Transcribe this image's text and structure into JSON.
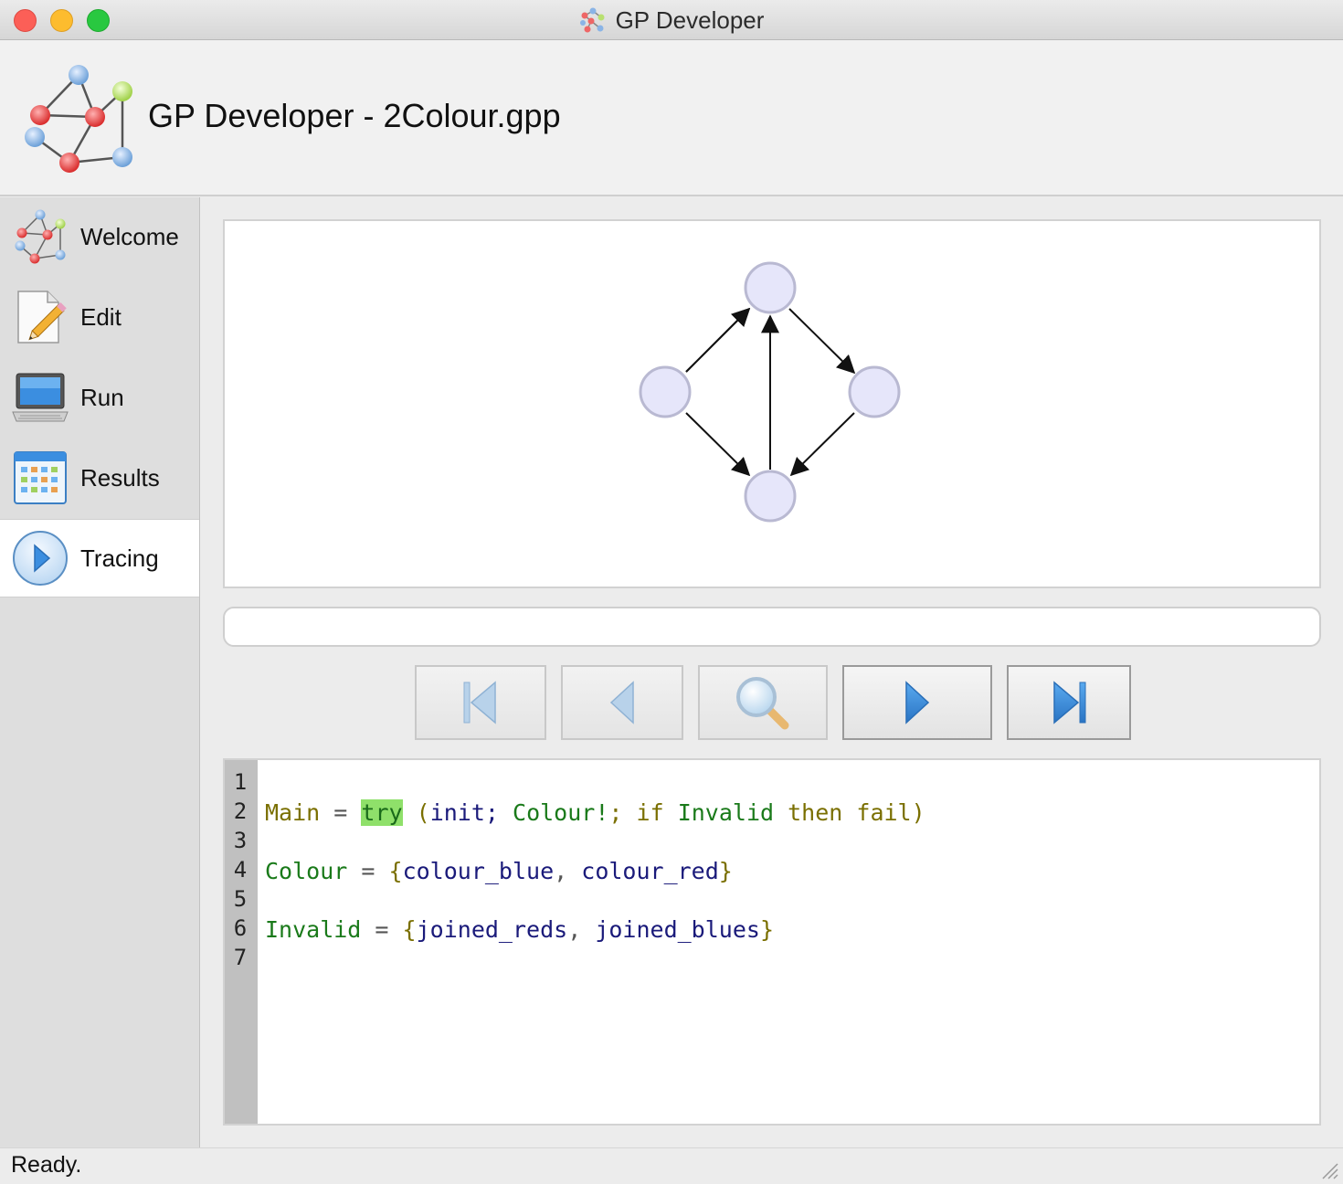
{
  "window": {
    "title": "GP Developer"
  },
  "header": {
    "title": "GP Developer - 2Colour.gpp"
  },
  "sidebar": {
    "items": [
      {
        "label": "Welcome",
        "icon": "graph-icon",
        "active": false
      },
      {
        "label": "Edit",
        "icon": "edit-document-icon",
        "active": false
      },
      {
        "label": "Run",
        "icon": "computer-icon",
        "active": false
      },
      {
        "label": "Results",
        "icon": "calendar-grid-icon",
        "active": false
      },
      {
        "label": "Tracing",
        "icon": "play-circle-icon",
        "active": true
      }
    ]
  },
  "trace_controls": [
    {
      "name": "skip-to-start",
      "icon": "skip-start-icon",
      "enabled": false
    },
    {
      "name": "step-back",
      "icon": "step-back-icon",
      "enabled": false
    },
    {
      "name": "find",
      "icon": "magnifier-icon",
      "enabled": false
    },
    {
      "name": "step-forward",
      "icon": "step-forward-icon",
      "enabled": true
    },
    {
      "name": "skip-to-end",
      "icon": "skip-end-icon",
      "enabled": true
    }
  ],
  "code": {
    "line_numbers": [
      "1",
      "2",
      "3",
      "4",
      "5",
      "6",
      "7"
    ],
    "line2": {
      "name": "Main",
      "eq": "=",
      "try": "try",
      "rest_open": "(",
      "init": "init",
      "sep1": ";",
      "colour": "Colour!",
      "sep2": ";",
      "if": "if",
      "invalid": "Invalid",
      "then": "then",
      "fail": "fail",
      "close": ")"
    },
    "line4": {
      "name": "Colour",
      "eq": "=",
      "open": "{",
      "r1": "colour_blue",
      "comma": ",",
      "r2": "colour_red",
      "close": "}"
    },
    "line6": {
      "name": "Invalid",
      "eq": "=",
      "open": "{",
      "r1": "joined_reds",
      "comma": ",",
      "r2": "joined_blues",
      "close": "}"
    }
  },
  "status": {
    "text": "Ready."
  },
  "colors": {
    "node_fill": "#e6e6fa",
    "node_stroke": "#b9b9d2",
    "highlight": "#8fe06a"
  }
}
